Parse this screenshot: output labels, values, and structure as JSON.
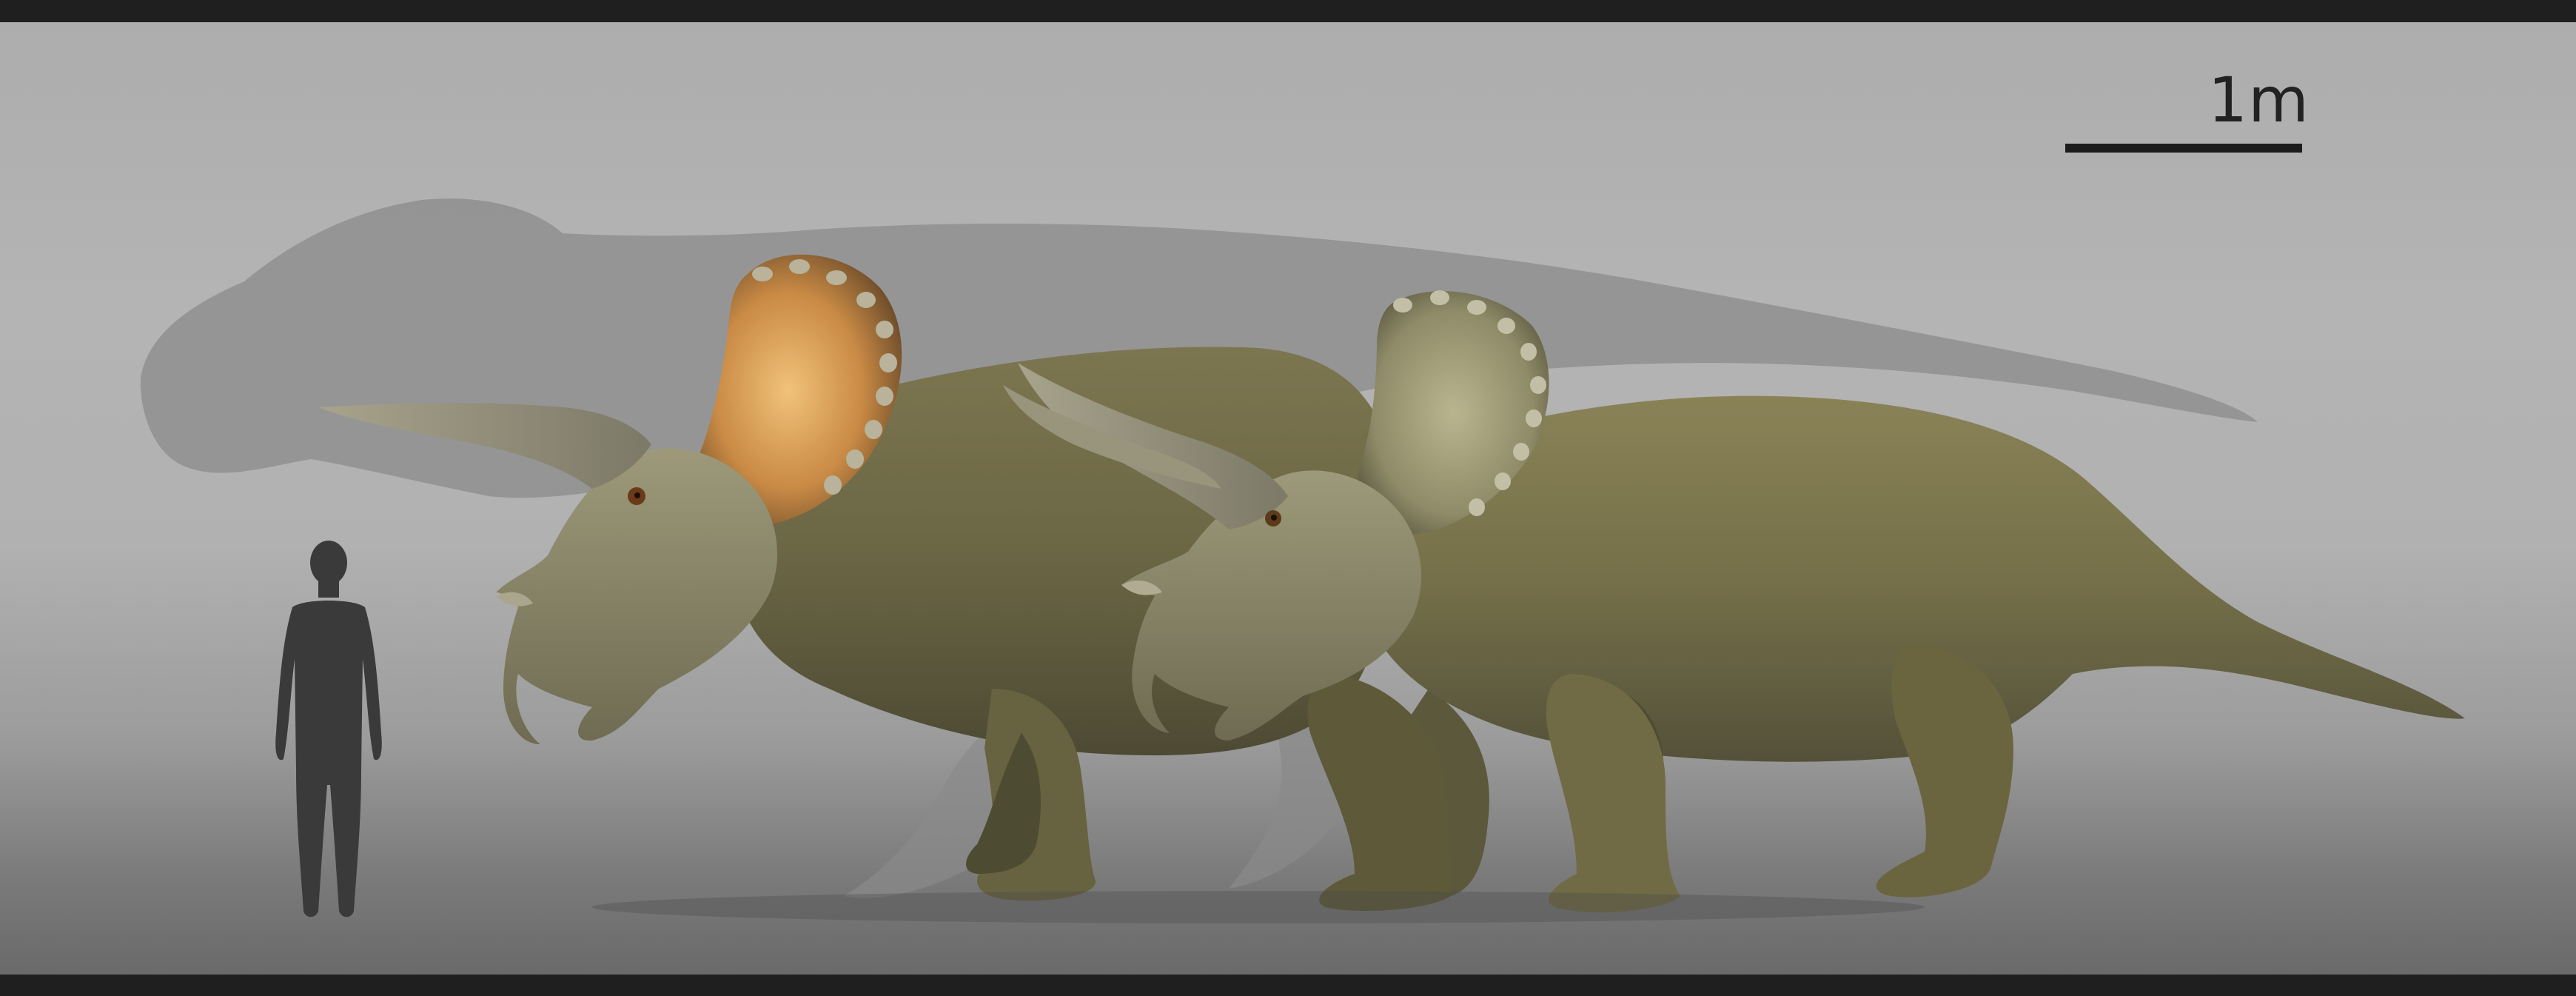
{
  "scale": {
    "label": "1m"
  },
  "figures": [
    {
      "name": "theropod-silhouette",
      "kind": "background size-comparison silhouette"
    },
    {
      "name": "human-silhouette",
      "kind": "human scale figure"
    },
    {
      "name": "triceratops-left",
      "kind": "ceratopsian render"
    },
    {
      "name": "triceratops-right",
      "kind": "ceratopsian render"
    }
  ],
  "colors": {
    "frame_border": "#1f1f1f",
    "background_top": "#b4b4b4",
    "background_bottom": "#6a6a6a",
    "silhouette_theropod": "#8f8f8f",
    "silhouette_human": "#3a3a3a",
    "scale_bar": "#1c1c1c",
    "scale_text": "#222222",
    "body_green": "#6f6a45",
    "frill_orange": "#d79a52"
  }
}
